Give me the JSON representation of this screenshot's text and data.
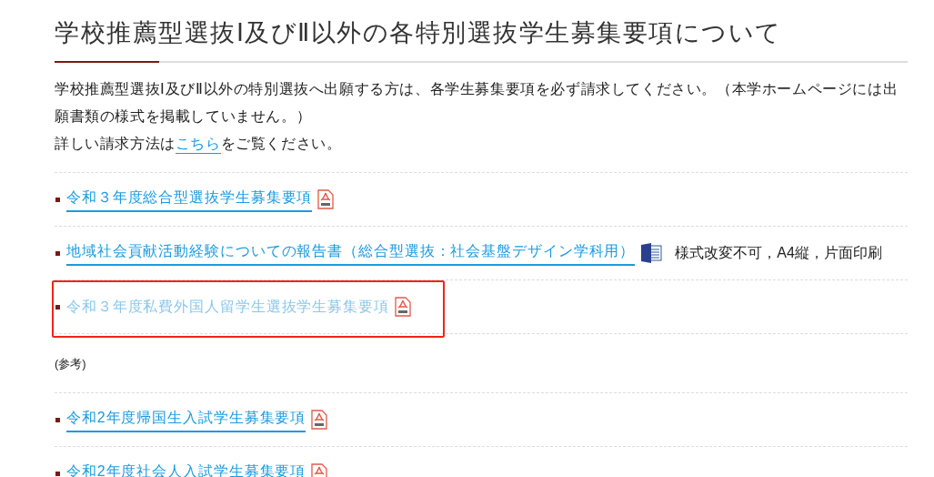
{
  "title": "学校推薦型選抜Ⅰ及びⅡ以外の各特別選抜学生募集要項について",
  "intro": {
    "paragraph": "学校推薦型選抜Ⅰ及びⅡ以外の特別選抜へ出願する方は、各学生募集要項を必ず請求してください。（本学ホームページには出願書類の様式を掲載していません。）",
    "before_link": "詳しい請求方法は",
    "link": "こちら",
    "after_link": "をご覧ください。"
  },
  "documents": [
    {
      "text": "令和３年度総合型選抜学生募集要項",
      "kind": "pdf",
      "visited": false,
      "highlighted": false
    },
    {
      "text": "地域社会貢献活動経験についての報告書（総合型選抜：社会基盤デザイン学科用）",
      "kind": "word",
      "note": "様式改変不可，A4縦，片面印刷",
      "visited": false,
      "highlighted": false
    },
    {
      "text": "令和３年度私費外国人留学生選抜学生募集要項",
      "kind": "pdf",
      "visited": true,
      "highlighted": true
    }
  ],
  "reference_label": "(参考)",
  "reference_documents": [
    {
      "text": "令和2年度帰国生入試学生募集要項",
      "kind": "pdf",
      "visited": false,
      "highlighted": false
    },
    {
      "text": "令和2年度社会人入試学生募集要項",
      "kind": "pdf",
      "visited": false,
      "highlighted": false
    }
  ]
}
